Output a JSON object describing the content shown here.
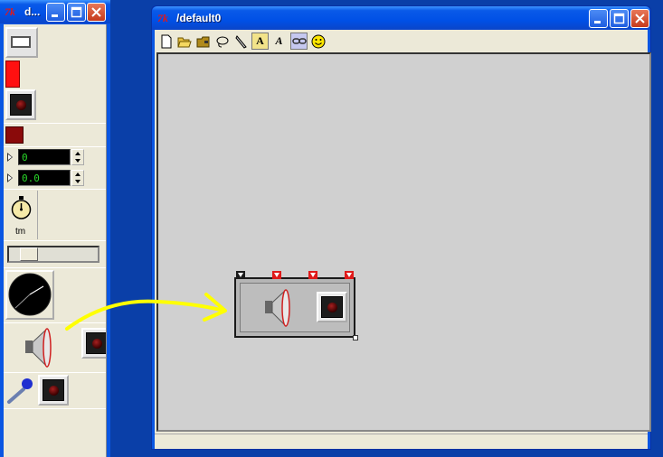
{
  "palette": {
    "title": "d...",
    "numbox1_value": "0",
    "numbox2_value": "0.0",
    "timer_label": "tm"
  },
  "main": {
    "title": "/default0",
    "toolbar": {
      "items": [
        "new",
        "open",
        "open-folder",
        "lasso",
        "pencil",
        "text-box",
        "text",
        "link",
        "smiley"
      ],
      "text_box_label": "A",
      "text_label": "A"
    }
  },
  "colors": {
    "titlebar": "#0054e3",
    "canvas": "#d0d0d0",
    "arrow": "#ffff00",
    "inlet_red": "#e01a1a",
    "number_text": "#29d829"
  }
}
